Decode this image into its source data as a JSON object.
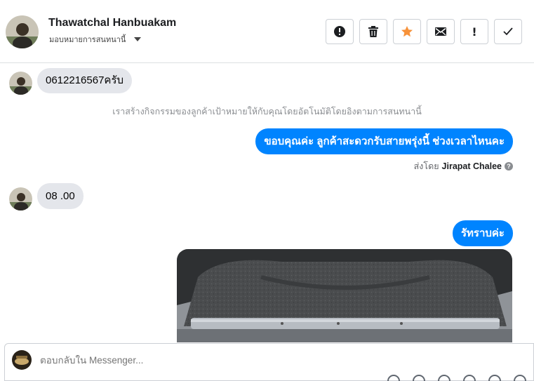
{
  "header": {
    "contact_name": "Thawatchal Hanbuakam",
    "assign_label": "มอบหมายการสนทนานี้",
    "actions": [
      {
        "name": "report-icon",
        "label": "!"
      },
      {
        "name": "trash-icon",
        "label": ""
      },
      {
        "name": "star-icon",
        "label": ""
      },
      {
        "name": "mail-icon",
        "label": ""
      },
      {
        "name": "exclamation-icon",
        "label": "!"
      },
      {
        "name": "check-icon",
        "label": ""
      }
    ]
  },
  "messages": {
    "incoming_1": "0612216567ครับ",
    "system_note": "เราสร้างกิจกรรมของลูกค้าเป้าหมายให้กับคุณโดยอัตโนมัติโดยอิงตามการสนทนานี้",
    "outgoing_1": "ขอบคุณค่ะ ลูกค้าสะดวกรับสายพรุ่งนี้ ช่วงเวลาไหนคะ",
    "sent_by_prefix": "ส่งโดย",
    "sent_by_name": "Jirapat Chalee",
    "incoming_2": "08 .00",
    "outgoing_2": "รัทราบค่ะ"
  },
  "composer": {
    "placeholder": "ตอบกลับใน Messenger..."
  },
  "colors": {
    "accent": "#0084ff",
    "incoming_bubble": "#e4e6eb",
    "star": "#f7923a"
  }
}
